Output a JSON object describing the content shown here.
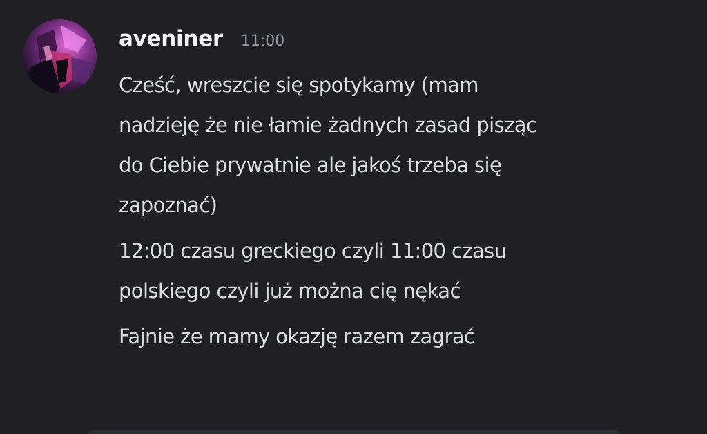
{
  "message": {
    "author": "aveniner",
    "time": "11:00",
    "lines": [
      "Cześć, wreszcie się spotykamy (mam\nnadzieję że nie łamie żadnych zasad pisząc\ndo Ciebie prywatnie ale jakoś trzeba się\nzapoznać)",
      "12:00 czasu greckiego czyli 11:00 czasu\npolskiego czyli już można cię nękać",
      "Fajnie że mamy okazję razem zagrać"
    ]
  }
}
